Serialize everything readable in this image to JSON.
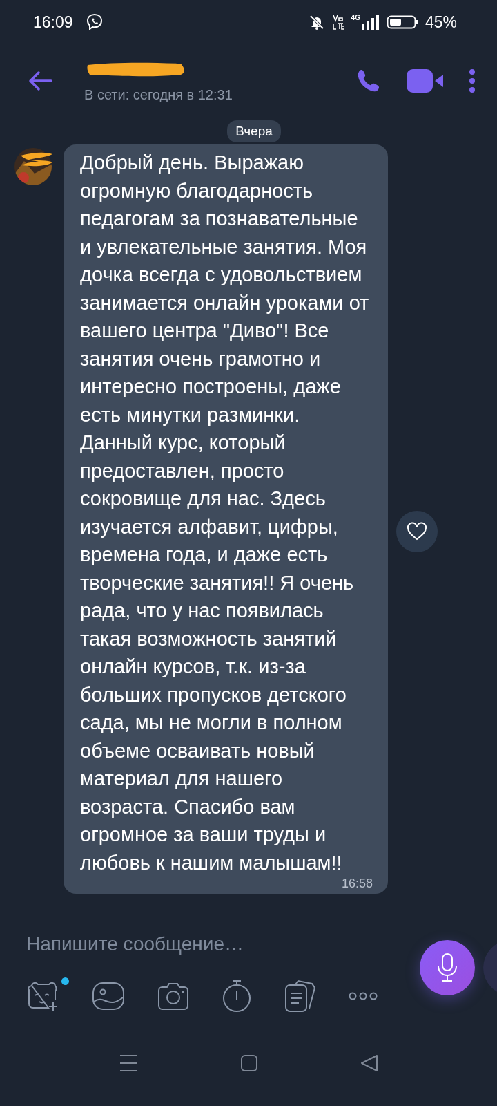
{
  "status_bar": {
    "time": "16:09",
    "battery": "45%",
    "network": "4G"
  },
  "header": {
    "subtitle": "В сети: сегодня в 12:31"
  },
  "chat": {
    "date_label": "Вчера",
    "messages": [
      {
        "text": "Добрый день. Выражаю огромную благодарность педагогам за познавательные и увлекательные занятия. Моя дочка всегда с удовольствием занимается онлайн уроками от вашего центра \"Диво\"! Все занятия очень грамотно и интересно построены, даже есть минутки разминки. Данный курс, который предоставлен, просто сокровище для нас. Здесь изучается алфавит, цифры, времена года, и даже есть творческие занятия!! Я очень рада, что у нас появилась такая возможность занятий онлайн курсов, т.к. из-за больших пропусков детского сада, мы не могли в полном объеме осваивать новый материал для нашего возраста. Спасибо вам огромное за ваши труды и любовь к нашим малышам!!",
        "time": "16:58",
        "liked": false
      }
    ]
  },
  "composer": {
    "placeholder": "Напишите сообщение…",
    "sticker_badge": true
  }
}
